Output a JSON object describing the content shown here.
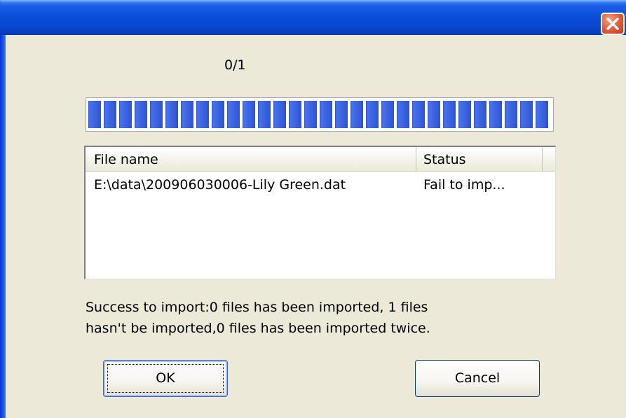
{
  "window": {
    "title": "",
    "close_icon": "close-icon",
    "colors": {
      "title_bar": "#0A4ED8",
      "close_button": "#E5633F",
      "dialog_background": "#ECE9D8",
      "progress_fill": "#2D53D6"
    }
  },
  "progress": {
    "count_text": "0/1",
    "fill_fraction": 1.0
  },
  "file_list": {
    "columns": [
      "File name",
      "Status"
    ],
    "rows": [
      {
        "file_name": "E:\\data\\200906030006-Lily Green.dat",
        "status": "Fail to imp..."
      }
    ]
  },
  "summary": {
    "line1": "Success to import:0 files has been imported, 1 files",
    "line2": "hasn't be imported,0 files has been imported twice."
  },
  "buttons": {
    "ok_label": "OK",
    "cancel_label": "Cancel"
  }
}
